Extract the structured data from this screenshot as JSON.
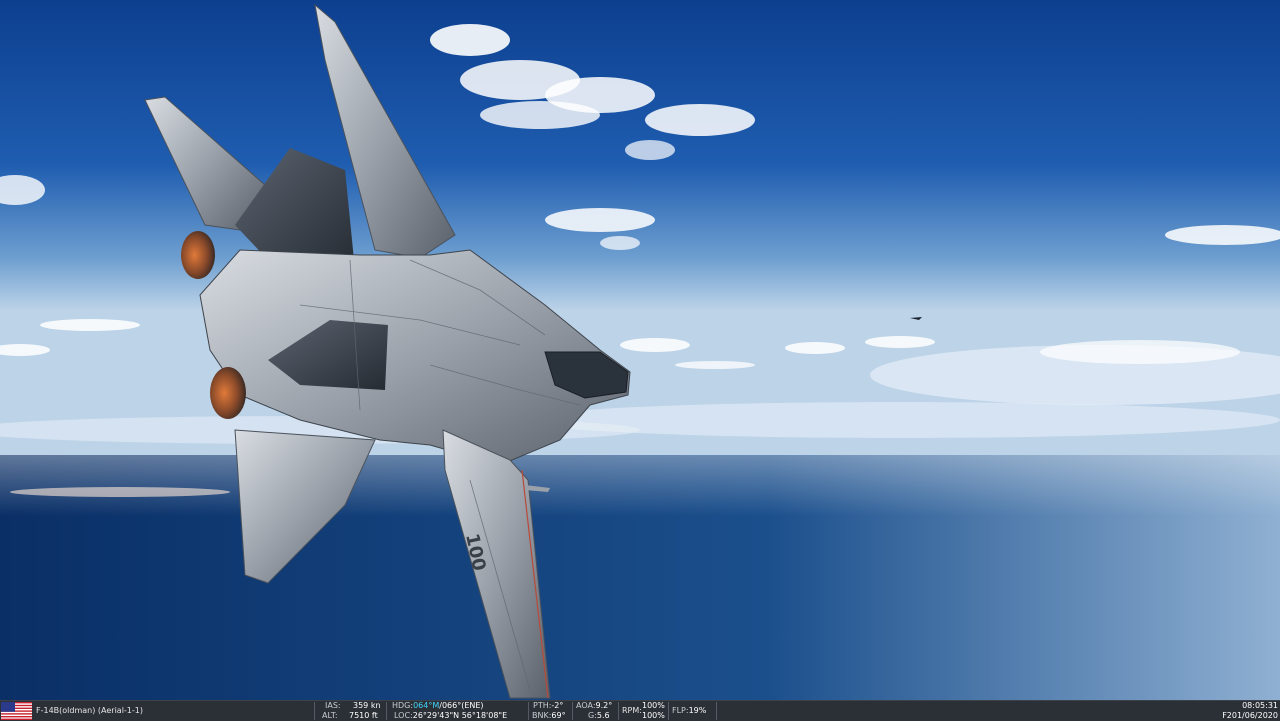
{
  "statusbar": {
    "aircraft": "F-14B(oldman) (Aerial-1-1)",
    "ias_label": "IAS:",
    "ias_value": "359 kn",
    "alt_label": "ALT:",
    "alt_value": "7510 ft",
    "hdg_label": "HDG:",
    "hdg_mag": "064°M",
    "hdg_true": "/066°(ENE)",
    "loc_label": "LOC:",
    "loc_value": "26°29'43\"N 56°18'08\"E",
    "pth_label": "PTH:",
    "pth_value": "-2°",
    "bnk_label": "BNK:",
    "bnk_value": "69°",
    "aoa_label": "AOA:",
    "aoa_value": "9.2°",
    "g_label": "G:",
    "g_value": "5.6",
    "rpm_label": "RPM:",
    "rpm_value1": "100%",
    "rpm_value2": "100%",
    "flp_label": "FLP:",
    "flp_value": "19%",
    "time": "08:05:31",
    "date": "F201/06/2020"
  },
  "scene": {
    "tail_number": "100"
  },
  "colors": {
    "sky_top": "#0d3f8f",
    "sky_horizon": "#bcd3e8",
    "sea": "#0a3470",
    "statusbar_bg": "#2b2f36",
    "heading_accent": "#3fd4ff"
  }
}
